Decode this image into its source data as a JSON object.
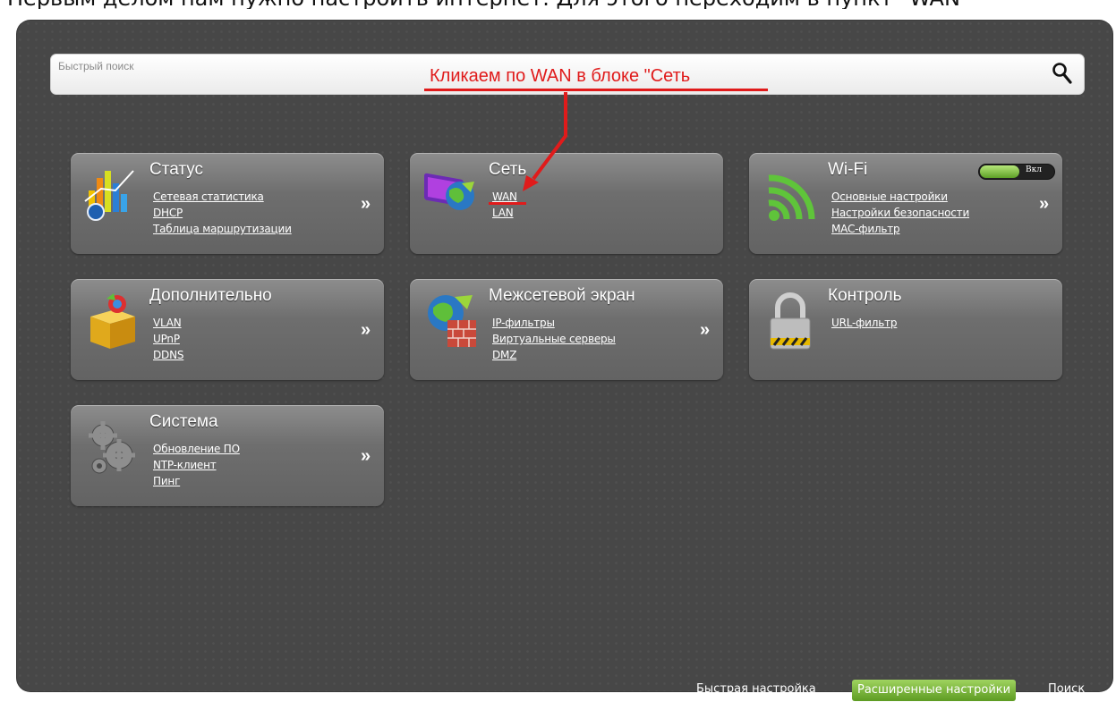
{
  "top_caption": "Первым делом нам нужно настроить интернет. Для этого переходим в пункт \"WAN\"",
  "search": {
    "placeholder": "Быстрый поиск",
    "icon": "search-icon"
  },
  "annotation": {
    "text": "Кликаем по WAN в блоке \"Сеть",
    "color": "#e01b1b"
  },
  "cards": {
    "status": {
      "title": "Статус",
      "icon": "chart-icon",
      "links": [
        "Сетевая статистика",
        "DHCP",
        "Таблица маршрутизации"
      ],
      "more": "»"
    },
    "network": {
      "title": "Сеть",
      "icon": "network-icon",
      "links": [
        "WAN",
        "LAN"
      ]
    },
    "wifi": {
      "title": "Wi-Fi",
      "icon": "wifi-icon",
      "toggle_label": "Вкл",
      "links": [
        "Основные настройки",
        "Настройки безопасности",
        "MAC-фильтр"
      ],
      "more": "»"
    },
    "advanced": {
      "title": "Дополнительно",
      "icon": "box-icon",
      "links": [
        "VLAN",
        "UPnP",
        "DDNS"
      ],
      "more": "»"
    },
    "firewall": {
      "title": "Межсетевой экран",
      "icon": "firewall-icon",
      "links": [
        "IP-фильтры",
        "Виртуальные серверы",
        "DMZ"
      ],
      "more": "»"
    },
    "control": {
      "title": "Контроль",
      "icon": "lock-icon",
      "links": [
        "URL-фильтр"
      ]
    },
    "system": {
      "title": "Система",
      "icon": "gears-icon",
      "links": [
        "Обновление ПО",
        "NTP-клиент",
        "Пинг"
      ],
      "more": "»"
    }
  },
  "footer": {
    "quick_setup": "Быстрая настройка",
    "advanced_settings": "Расширенные настройки",
    "search": "Поиск"
  },
  "colors": {
    "background": "#474747",
    "card": "#6e6e6e",
    "accent_green": "#7fc047",
    "annotation_red": "#e01b1b"
  }
}
